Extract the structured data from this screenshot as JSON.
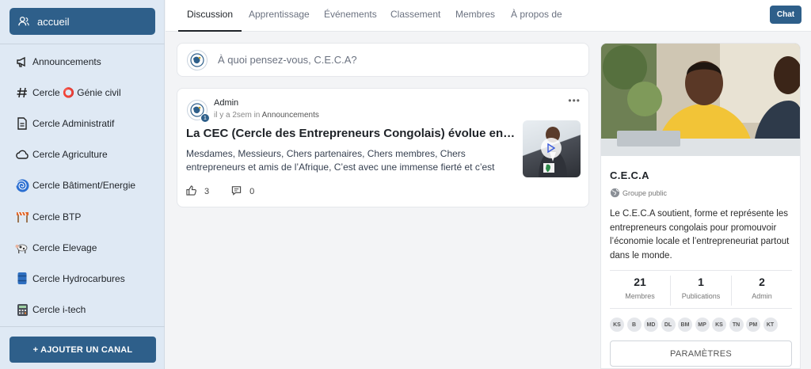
{
  "sidebar": {
    "home_label": "accueil",
    "items": [
      {
        "icon": "megaphone-icon",
        "label": "Announcements"
      },
      {
        "icon": "hash-icon",
        "label": "Cercle ⭕ Génie civil"
      },
      {
        "icon": "document-icon",
        "label": "Cercle Administratif"
      },
      {
        "icon": "cloud-icon",
        "label": "Cercle Agriculture"
      },
      {
        "icon": "spiral-icon",
        "label": "Cercle Bâtiment/Energie"
      },
      {
        "icon": "construction-icon",
        "label": "Cercle BTP"
      },
      {
        "icon": "cow-icon",
        "label": "Cercle Elevage"
      },
      {
        "icon": "barrel-icon",
        "label": "Cercle Hydrocarbures"
      },
      {
        "icon": "calculator-icon",
        "label": "Cercle i-tech"
      }
    ],
    "add_channel_label": "+ AJOUTER UN CANAL"
  },
  "nav": {
    "tabs": [
      "Discussion",
      "Apprentissage",
      "Événements",
      "Classement",
      "Membres",
      "À propos de"
    ],
    "active_tab": "Discussion",
    "chat_label": "Chat"
  },
  "composer": {
    "placeholder": "À quoi pensez-vous, C.E.C.A?"
  },
  "post": {
    "author": "Admin",
    "badge": "1",
    "time": "il y a 2sem",
    "in_word": "in",
    "channel": "Announcements",
    "title": "La CEC (Cercle des Entrepreneurs Congolais) évolue en CECA (C...",
    "excerpt": "Mesdames, Messieurs, Chers partenaires, Chers membres, Chers entrepreneurs et amis de l’Afrique, C’est avec une immense fierté et c’est avec une grande émotion...",
    "likes": "3",
    "comments": "0"
  },
  "group": {
    "name": "C.E.C.A",
    "type": "Groupe public",
    "description": "Le C.E.C.A soutient, forme et représente les entrepreneurs congolais pour promouvoir l’économie locale et l’entrepreneuriat partout dans le monde.",
    "stats": [
      {
        "value": "21",
        "label": "Membres"
      },
      {
        "value": "1",
        "label": "Publications"
      },
      {
        "value": "2",
        "label": "Admin"
      }
    ],
    "avatars": [
      "KS",
      "B",
      "MD",
      "DL",
      "BM",
      "MP",
      "KS",
      "TN",
      "PM",
      "KT"
    ],
    "settings_label": "PARAMÈTRES"
  },
  "colors": {
    "accent": "#2e5f8a",
    "sidebar_bg": "#dfe9f4"
  }
}
